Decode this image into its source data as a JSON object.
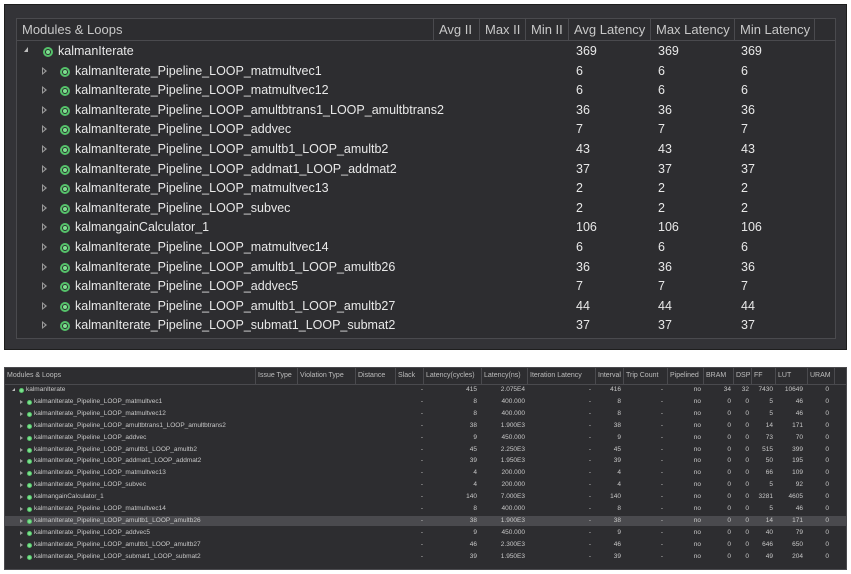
{
  "top_table": {
    "columns": [
      "Modules & Loops",
      "Avg II",
      "Max II",
      "Min II",
      "Avg Latency",
      "Max Latency",
      "Min Latency"
    ],
    "rows": [
      {
        "name": "kalmanIterate",
        "avg_lat": "369",
        "max_lat": "369",
        "min_lat": "369",
        "expanded": true,
        "level": 0
      },
      {
        "name": "kalmanIterate_Pipeline_LOOP_matmultvec1",
        "avg_lat": "6",
        "max_lat": "6",
        "min_lat": "6",
        "level": 1
      },
      {
        "name": "kalmanIterate_Pipeline_LOOP_matmultvec12",
        "avg_lat": "6",
        "max_lat": "6",
        "min_lat": "6",
        "level": 1
      },
      {
        "name": "kalmanIterate_Pipeline_LOOP_amultbtrans1_LOOP_amultbtrans2",
        "avg_lat": "36",
        "max_lat": "36",
        "min_lat": "36",
        "level": 1
      },
      {
        "name": "kalmanIterate_Pipeline_LOOP_addvec",
        "avg_lat": "7",
        "max_lat": "7",
        "min_lat": "7",
        "level": 1
      },
      {
        "name": "kalmanIterate_Pipeline_LOOP_amultb1_LOOP_amultb2",
        "avg_lat": "43",
        "max_lat": "43",
        "min_lat": "43",
        "level": 1
      },
      {
        "name": "kalmanIterate_Pipeline_LOOP_addmat1_LOOP_addmat2",
        "avg_lat": "37",
        "max_lat": "37",
        "min_lat": "37",
        "level": 1
      },
      {
        "name": "kalmanIterate_Pipeline_LOOP_matmultvec13",
        "avg_lat": "2",
        "max_lat": "2",
        "min_lat": "2",
        "level": 1
      },
      {
        "name": "kalmanIterate_Pipeline_LOOP_subvec",
        "avg_lat": "2",
        "max_lat": "2",
        "min_lat": "2",
        "level": 1
      },
      {
        "name": "kalmangainCalculator_1",
        "avg_lat": "106",
        "max_lat": "106",
        "min_lat": "106",
        "level": 1
      },
      {
        "name": "kalmanIterate_Pipeline_LOOP_matmultvec14",
        "avg_lat": "6",
        "max_lat": "6",
        "min_lat": "6",
        "level": 1
      },
      {
        "name": "kalmanIterate_Pipeline_LOOP_amultb1_LOOP_amultb26",
        "avg_lat": "36",
        "max_lat": "36",
        "min_lat": "36",
        "level": 1
      },
      {
        "name": "kalmanIterate_Pipeline_LOOP_addvec5",
        "avg_lat": "7",
        "max_lat": "7",
        "min_lat": "7",
        "level": 1
      },
      {
        "name": "kalmanIterate_Pipeline_LOOP_amultb1_LOOP_amultb27",
        "avg_lat": "44",
        "max_lat": "44",
        "min_lat": "44",
        "level": 1
      },
      {
        "name": "kalmanIterate_Pipeline_LOOP_submat1_LOOP_submat2",
        "avg_lat": "37",
        "max_lat": "37",
        "min_lat": "37",
        "level": 1
      }
    ]
  },
  "bottom_table": {
    "columns": [
      "Modules & Loops",
      "Issue Type",
      "Violation Type",
      "Distance",
      "Slack",
      "Latency(cycles)",
      "Latency(ns)",
      "Iteration Latency",
      "Interval",
      "Trip Count",
      "Pipelined",
      "BRAM",
      "DSP",
      "FF",
      "LUT",
      "URAM"
    ],
    "rows": [
      {
        "name": "kalmanIterate",
        "slack": "-",
        "lat_cycles": "415",
        "lat_ns": "2.075E4",
        "iter_lat": "-",
        "interval": "416",
        "trip": "-",
        "pipelined": "no",
        "bram": "34",
        "dsp": "32",
        "ff": "7430",
        "lut": "10649",
        "uram": "0",
        "level": 0,
        "expanded": true
      },
      {
        "name": "kalmanIterate_Pipeline_LOOP_matmultvec1",
        "slack": "-",
        "lat_cycles": "8",
        "lat_ns": "400.000",
        "iter_lat": "-",
        "interval": "8",
        "trip": "-",
        "pipelined": "no",
        "bram": "0",
        "dsp": "0",
        "ff": "5",
        "lut": "46",
        "uram": "0",
        "level": 1
      },
      {
        "name": "kalmanIterate_Pipeline_LOOP_matmultvec12",
        "slack": "-",
        "lat_cycles": "8",
        "lat_ns": "400.000",
        "iter_lat": "-",
        "interval": "8",
        "trip": "-",
        "pipelined": "no",
        "bram": "0",
        "dsp": "0",
        "ff": "5",
        "lut": "46",
        "uram": "0",
        "level": 1
      },
      {
        "name": "kalmanIterate_Pipeline_LOOP_amultbtrans1_LOOP_amultbtrans2",
        "slack": "-",
        "lat_cycles": "38",
        "lat_ns": "1.900E3",
        "iter_lat": "-",
        "interval": "38",
        "trip": "-",
        "pipelined": "no",
        "bram": "0",
        "dsp": "0",
        "ff": "14",
        "lut": "171",
        "uram": "0",
        "level": 1
      },
      {
        "name": "kalmanIterate_Pipeline_LOOP_addvec",
        "slack": "-",
        "lat_cycles": "9",
        "lat_ns": "450.000",
        "iter_lat": "-",
        "interval": "9",
        "trip": "-",
        "pipelined": "no",
        "bram": "0",
        "dsp": "0",
        "ff": "73",
        "lut": "70",
        "uram": "0",
        "level": 1
      },
      {
        "name": "kalmanIterate_Pipeline_LOOP_amultb1_LOOP_amultb2",
        "slack": "-",
        "lat_cycles": "45",
        "lat_ns": "2.250E3",
        "iter_lat": "-",
        "interval": "45",
        "trip": "-",
        "pipelined": "no",
        "bram": "0",
        "dsp": "0",
        "ff": "515",
        "lut": "399",
        "uram": "0",
        "level": 1
      },
      {
        "name": "kalmanIterate_Pipeline_LOOP_addmat1_LOOP_addmat2",
        "slack": "-",
        "lat_cycles": "39",
        "lat_ns": "1.950E3",
        "iter_lat": "-",
        "interval": "39",
        "trip": "-",
        "pipelined": "no",
        "bram": "0",
        "dsp": "0",
        "ff": "50",
        "lut": "195",
        "uram": "0",
        "level": 1
      },
      {
        "name": "kalmanIterate_Pipeline_LOOP_matmultvec13",
        "slack": "-",
        "lat_cycles": "4",
        "lat_ns": "200.000",
        "iter_lat": "-",
        "interval": "4",
        "trip": "-",
        "pipelined": "no",
        "bram": "0",
        "dsp": "0",
        "ff": "66",
        "lut": "109",
        "uram": "0",
        "level": 1
      },
      {
        "name": "kalmanIterate_Pipeline_LOOP_subvec",
        "slack": "-",
        "lat_cycles": "4",
        "lat_ns": "200.000",
        "iter_lat": "-",
        "interval": "4",
        "trip": "-",
        "pipelined": "no",
        "bram": "0",
        "dsp": "0",
        "ff": "5",
        "lut": "92",
        "uram": "0",
        "level": 1
      },
      {
        "name": "kalmangainCalculator_1",
        "slack": "-",
        "lat_cycles": "140",
        "lat_ns": "7.000E3",
        "iter_lat": "-",
        "interval": "140",
        "trip": "-",
        "pipelined": "no",
        "bram": "0",
        "dsp": "0",
        "ff": "3281",
        "lut": "4605",
        "uram": "0",
        "level": 1
      },
      {
        "name": "kalmanIterate_Pipeline_LOOP_matmultvec14",
        "slack": "-",
        "lat_cycles": "8",
        "lat_ns": "400.000",
        "iter_lat": "-",
        "interval": "8",
        "trip": "-",
        "pipelined": "no",
        "bram": "0",
        "dsp": "0",
        "ff": "5",
        "lut": "46",
        "uram": "0",
        "level": 1
      },
      {
        "name": "kalmanIterate_Pipeline_LOOP_amultb1_LOOP_amultb26",
        "slack": "-",
        "lat_cycles": "38",
        "lat_ns": "1.900E3",
        "iter_lat": "-",
        "interval": "38",
        "trip": "-",
        "pipelined": "no",
        "bram": "0",
        "dsp": "0",
        "ff": "14",
        "lut": "171",
        "uram": "0",
        "level": 1,
        "selected": true
      },
      {
        "name": "kalmanIterate_Pipeline_LOOP_addvec5",
        "slack": "-",
        "lat_cycles": "9",
        "lat_ns": "450.000",
        "iter_lat": "-",
        "interval": "9",
        "trip": "-",
        "pipelined": "no",
        "bram": "0",
        "dsp": "0",
        "ff": "40",
        "lut": "79",
        "uram": "0",
        "level": 1
      },
      {
        "name": "kalmanIterate_Pipeline_LOOP_amultb1_LOOP_amultb27",
        "slack": "-",
        "lat_cycles": "46",
        "lat_ns": "2.300E3",
        "iter_lat": "-",
        "interval": "46",
        "trip": "-",
        "pipelined": "no",
        "bram": "0",
        "dsp": "0",
        "ff": "646",
        "lut": "650",
        "uram": "0",
        "level": 1
      },
      {
        "name": "kalmanIterate_Pipeline_LOOP_submat1_LOOP_submat2",
        "slack": "-",
        "lat_cycles": "39",
        "lat_ns": "1.950E3",
        "iter_lat": "-",
        "interval": "39",
        "trip": "-",
        "pipelined": "no",
        "bram": "0",
        "dsp": "0",
        "ff": "49",
        "lut": "204",
        "uram": "0",
        "level": 1
      }
    ]
  }
}
